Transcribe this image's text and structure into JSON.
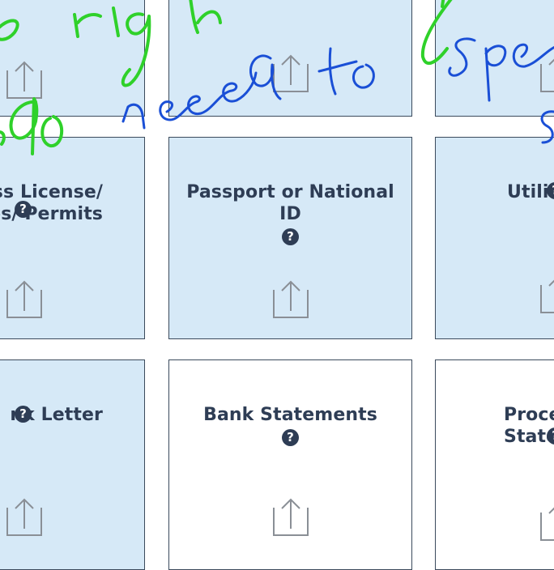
{
  "cards": [
    {
      "key": "top-left",
      "title": "",
      "help": ""
    },
    {
      "key": "top-center",
      "title": "",
      "help": ""
    },
    {
      "key": "top-right",
      "title": "",
      "help": ""
    },
    {
      "key": "drivers-license",
      "title": "ess License/\nates/ Permits",
      "help": "?"
    },
    {
      "key": "passport",
      "title": "Passport or National\nID",
      "help": "?"
    },
    {
      "key": "utility",
      "title": "Utility",
      "help": "?"
    },
    {
      "key": "bank-letter",
      "title": "nk Letter",
      "help": "?"
    },
    {
      "key": "bank-statements",
      "title": "Bank Statements",
      "help": "?"
    },
    {
      "key": "processing-statements",
      "title": "Proce\nState",
      "help": "?"
    }
  ],
  "annotation": {
    "green_text": "s righ",
    "blue_text": "need to",
    "blue_text_right": "spe",
    "green_text_left": "do"
  },
  "colors": {
    "card_light": "#d6e9f7",
    "card_white": "#ffffff",
    "text": "#2e3d55",
    "ink_green": "#2fd12a",
    "ink_blue": "#1a4fd6"
  },
  "icons": {
    "upload": "upload-icon",
    "help": "question-circle-icon"
  }
}
